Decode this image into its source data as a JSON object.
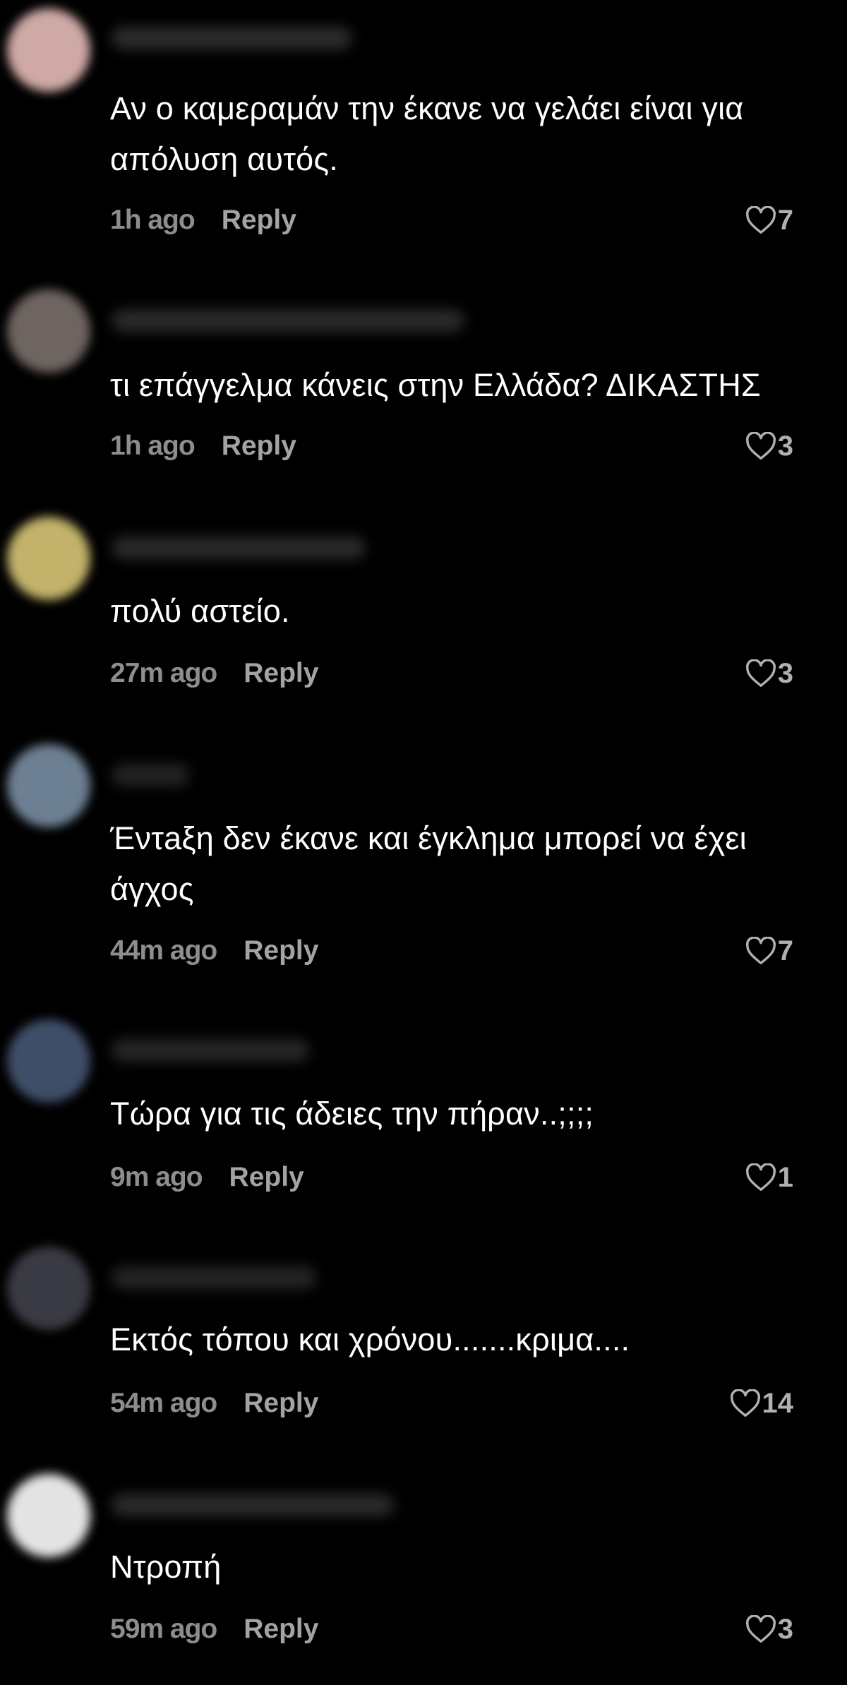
{
  "colors": {
    "background": "#000000",
    "text": "#ffffff",
    "timestamp": "#8d8d8d",
    "reply": "#a3a3a3",
    "likes": "#b0b0b0"
  },
  "comments": [
    {
      "text": "Αν ο καμεραμάν την έκανε να γελάει είναι για απόλυση αυτός.",
      "time": "1h ago",
      "reply_label": "Reply",
      "likes": "7",
      "like_icon": "heart-outline-icon",
      "avatar_color": "#cfa9a6",
      "username_redacted": true
    },
    {
      "text": "τι επάγγελμα κάνεις στην Ελλάδα? ΔΙΚΑΣΤΗΣ",
      "time": "1h ago",
      "reply_label": "Reply",
      "likes": "3",
      "like_icon": "heart-outline-icon",
      "avatar_color": "#6e6460",
      "username_redacted": true
    },
    {
      "text": "πολύ αστείο.",
      "time": "27m ago",
      "reply_label": "Reply",
      "likes": "3",
      "like_icon": "heart-outline-icon",
      "avatar_color": "#c2b26a",
      "username_redacted": true
    },
    {
      "text": "Έντaξη δεν έκανε και έγκλημα μπορεί να έχει άγχος",
      "time": "44m ago",
      "reply_label": "Reply",
      "likes": "7",
      "like_icon": "heart-outline-icon",
      "avatar_color": "#6d8093",
      "username_redacted": true
    },
    {
      "text": "Τώρα για τις άδειες την πήραν..;;;;",
      "time": "9m ago",
      "reply_label": "Reply",
      "likes": "1",
      "like_icon": "heart-outline-icon",
      "avatar_color": "#3f4e68",
      "username_redacted": true
    },
    {
      "text": "Εκτός τόπου και χρόνου.......κριμα....",
      "time": "54m ago",
      "reply_label": "Reply",
      "likes": "14",
      "like_icon": "heart-outline-icon",
      "avatar_color": "#3a3a44",
      "username_redacted": true
    },
    {
      "text": "Ντροπή",
      "time": "59m ago",
      "reply_label": "Reply",
      "likes": "3",
      "like_icon": "heart-outline-icon",
      "avatar_color": "#e4e4e4",
      "username_redacted": true
    }
  ]
}
